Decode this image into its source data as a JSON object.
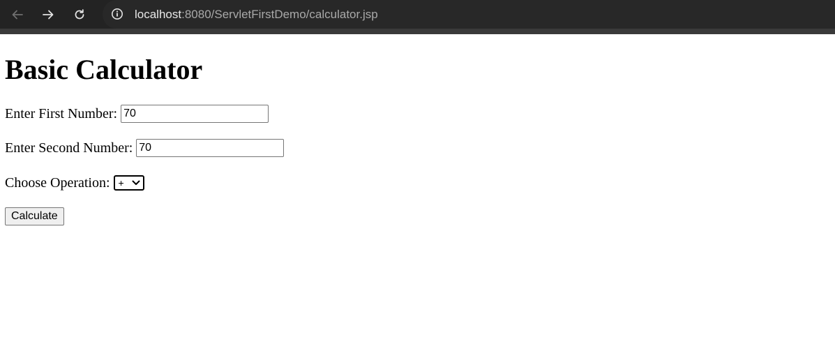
{
  "browser": {
    "url_host": "localhost",
    "url_path": ":8080/ServletFirstDemo/calculator.jsp",
    "icons": [
      "back-arrow-icon",
      "forward-arrow-icon",
      "reload-icon",
      "site-info-icon"
    ]
  },
  "page": {
    "title": "Basic Calculator",
    "first_number_label": "Enter First Number:",
    "first_number_value": "70",
    "second_number_label": "Enter Second Number:",
    "second_number_value": "70",
    "operation_label": "Choose Operation:",
    "operation_selected": "+",
    "calculate_label": "Calculate"
  }
}
